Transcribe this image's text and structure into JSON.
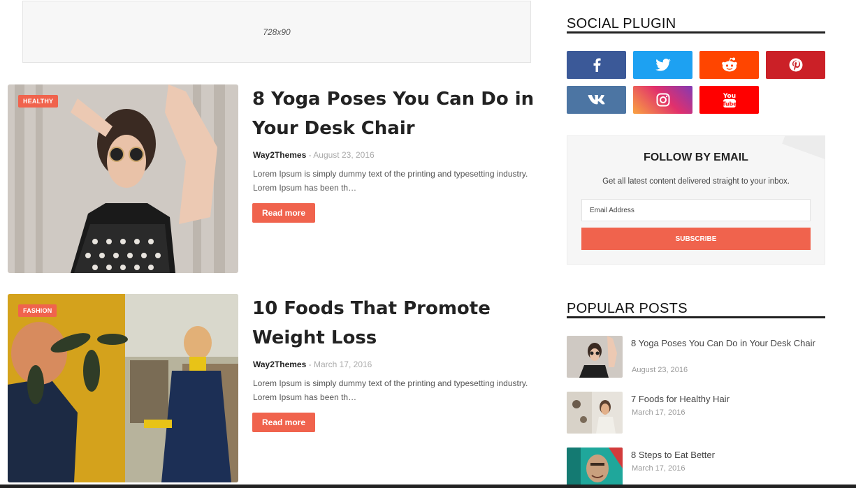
{
  "ad": {
    "label": "728x90"
  },
  "posts": [
    {
      "category": "HEALTHY",
      "title": "8 Yoga Poses You Can Do in Your Desk Chair",
      "author": "Way2Themes",
      "separator": "-",
      "date": "August 23, 2016",
      "excerpt": "Lorem Ipsum is simply dummy text of the printing and typesetting industry. Lorem Ipsum has been th…",
      "read_more": "Read more"
    },
    {
      "category": "FASHION",
      "title": "10 Foods That Promote Weight Loss",
      "author": "Way2Themes",
      "separator": "-",
      "date": "March 17, 2016",
      "excerpt": "Lorem Ipsum is simply dummy text of the printing and typesetting industry. Lorem Ipsum has been th…",
      "read_more": "Read more"
    }
  ],
  "sidebar": {
    "social_heading": "SOCIAL PLUGIN",
    "social": [
      {
        "icon": "facebook-icon",
        "color": "#3b5998"
      },
      {
        "icon": "twitter-icon",
        "color": "#1da1f2"
      },
      {
        "icon": "reddit-icon",
        "color": "#ff4500"
      },
      {
        "icon": "pinterest-icon",
        "color": "#cb2027"
      },
      {
        "icon": "vk-icon",
        "color": "#4c75a3"
      },
      {
        "icon": "instagram-icon",
        "color": "#c13584"
      },
      {
        "icon": "youtube-icon",
        "color": "#ff0000"
      }
    ],
    "follow": {
      "heading": "FOLLOW BY EMAIL",
      "description": "Get all latest content delivered straight to your inbox.",
      "placeholder": "Email Address",
      "subscribe": "SUBSCRIBE"
    },
    "popular_heading": "POPULAR POSTS",
    "popular": [
      {
        "title": "8 Yoga Poses You Can Do in Your Desk Chair",
        "date": "August 23, 2016"
      },
      {
        "title": "7 Foods for Healthy Hair",
        "date": "March 17, 2016"
      },
      {
        "title": "8 Steps to Eat Better",
        "date": "March 17, 2016"
      }
    ]
  },
  "colors": {
    "accent": "#f0634d"
  }
}
